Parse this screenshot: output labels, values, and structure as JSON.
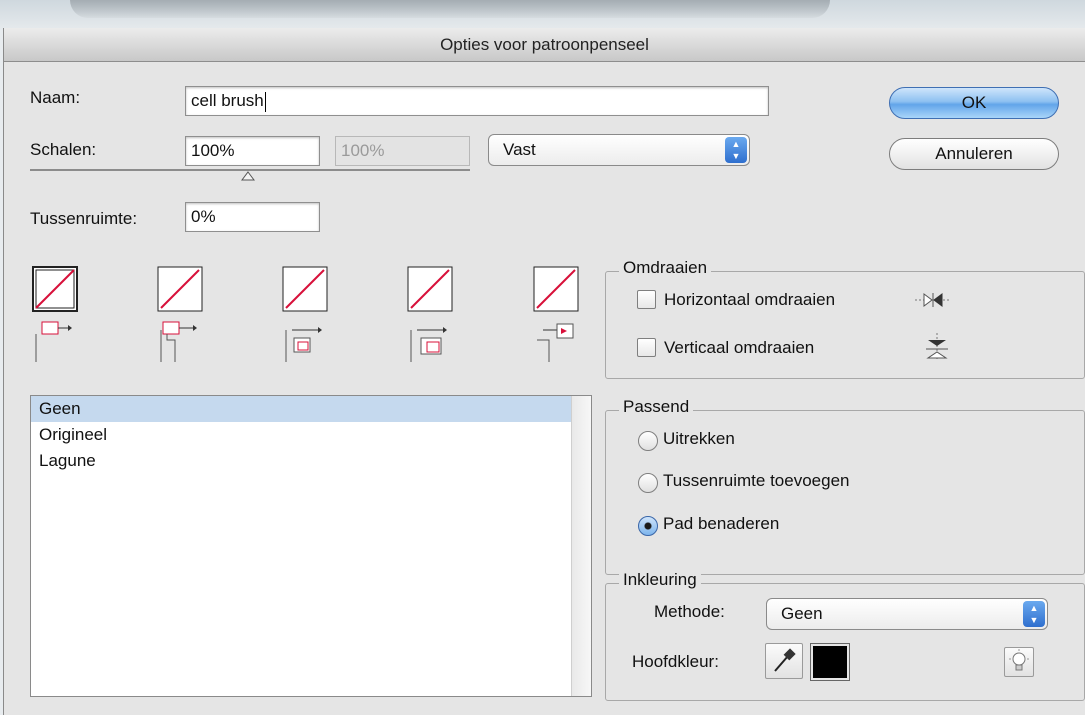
{
  "dialog": {
    "title": "Opties voor patroonpenseel"
  },
  "name": {
    "label": "Naam:",
    "value": "cell brush"
  },
  "scale": {
    "label": "Schalen:",
    "value": "100%",
    "value2": "100%",
    "mode": "Vast"
  },
  "spacing": {
    "label": "Tussenruimte:",
    "value": "0%"
  },
  "buttons": {
    "ok": "OK",
    "cancel": "Annuleren"
  },
  "tiles": [
    {
      "name": "side-tile",
      "icon": "side-tile-icon"
    },
    {
      "name": "outer-corner-tile",
      "icon": "outer-corner-tile-icon"
    },
    {
      "name": "inner-corner-tile",
      "icon": "inner-corner-tile-icon"
    },
    {
      "name": "start-tile",
      "icon": "start-tile-icon"
    },
    {
      "name": "end-tile",
      "icon": "end-tile-icon"
    }
  ],
  "pattern_list": {
    "items": [
      "Geen",
      "Origineel",
      "Lagune"
    ],
    "selected": "Geen"
  },
  "flip": {
    "title": "Omdraaien",
    "horizontal": {
      "label": "Horizontaal omdraaien",
      "checked": false
    },
    "vertical": {
      "label": "Verticaal omdraaien",
      "checked": false
    }
  },
  "fit": {
    "title": "Passend",
    "options": [
      "Uitrekken",
      "Tussenruimte toevoegen",
      "Pad benaderen"
    ],
    "selected": "Pad benaderen"
  },
  "colorization": {
    "title": "Inkleuring",
    "method_label": "Methode:",
    "method_value": "Geen",
    "key_color_label": "Hoofdkleur:",
    "key_color": "#000000"
  },
  "colors": {
    "accent": "#d8103a",
    "selection": "#c5d9ee"
  }
}
